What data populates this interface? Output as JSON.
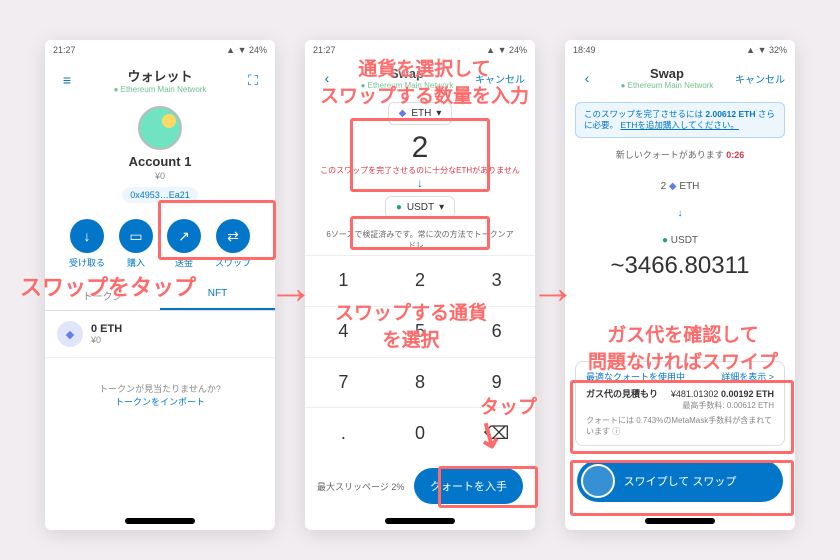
{
  "status": {
    "time1": "21:27",
    "time3": "18:49",
    "right": "▲ ▼ 24%",
    "right3": "▲ ▼ 32%",
    "icons": "◦ ▲ ☰ …"
  },
  "p1": {
    "title": "ウォレット",
    "subtitle": "● Ethereum Main Network",
    "account": "Account 1",
    "balance_jpy": "¥0",
    "address": "0x4953…Ea21",
    "actions": {
      "receive": "受け取る",
      "buy": "購入",
      "send": "送金",
      "swap": "スワップ"
    },
    "tabs": {
      "tokens": "トークン",
      "nft": "NFT"
    },
    "token": {
      "sym": "0 ETH",
      "sub": "¥0"
    },
    "empty": {
      "q": "トークンが見当たりませんか?",
      "link": "トークンをインポート"
    }
  },
  "p2": {
    "title": "Swap",
    "cancel": "キャンセル",
    "from_token": "ETH",
    "amount": "2",
    "warn": "このスワップを完了させるのに十分なETHがありません",
    "to_token": "USDT",
    "note": "6ソースで検証済みです。常に次の方法でトークンアドレ…",
    "keys": [
      "1",
      "2",
      "3",
      "4",
      "5",
      "6",
      "7",
      "8",
      "9",
      ".",
      "0",
      "⌫"
    ],
    "slippage": "最大スリッページ 2%",
    "cta": "クォートを入手"
  },
  "p3": {
    "title": "Swap",
    "cancel": "キャンセル",
    "banner_a": "このスワップを完了させるには ",
    "banner_b": "2.00612 ETH",
    "banner_c": " さらに必要。",
    "banner_link": "ETHを追加購入してください。",
    "quote_note": "新しいクォートがあります ",
    "quote_timer": "0:26",
    "from": "2",
    "from_tok": "ETH",
    "to_tok": "USDT",
    "result": "~3466.80311",
    "gas": {
      "head": "最適なクォートを使用中",
      "detail": "詳細を表示 >",
      "label": "ガス代の見積もり",
      "jpy": "¥481.01302",
      "eth": "0.00192 ETH",
      "max": "最高手数料: 0.00612 ETH",
      "foot": "クォートには 0.743%のMetaMask手数料が含まれています ⓘ"
    },
    "swipe": "スワイプして スワップ"
  },
  "annots": {
    "a1": "スワップをタップ",
    "a2_top": "通貨を選択して\nスワップする数量を入力",
    "a2_mid": "スワップする通貨\nを選択",
    "a2_tap": "タップ",
    "a3": "ガス代を確認して\n問題なければスワイプ"
  }
}
